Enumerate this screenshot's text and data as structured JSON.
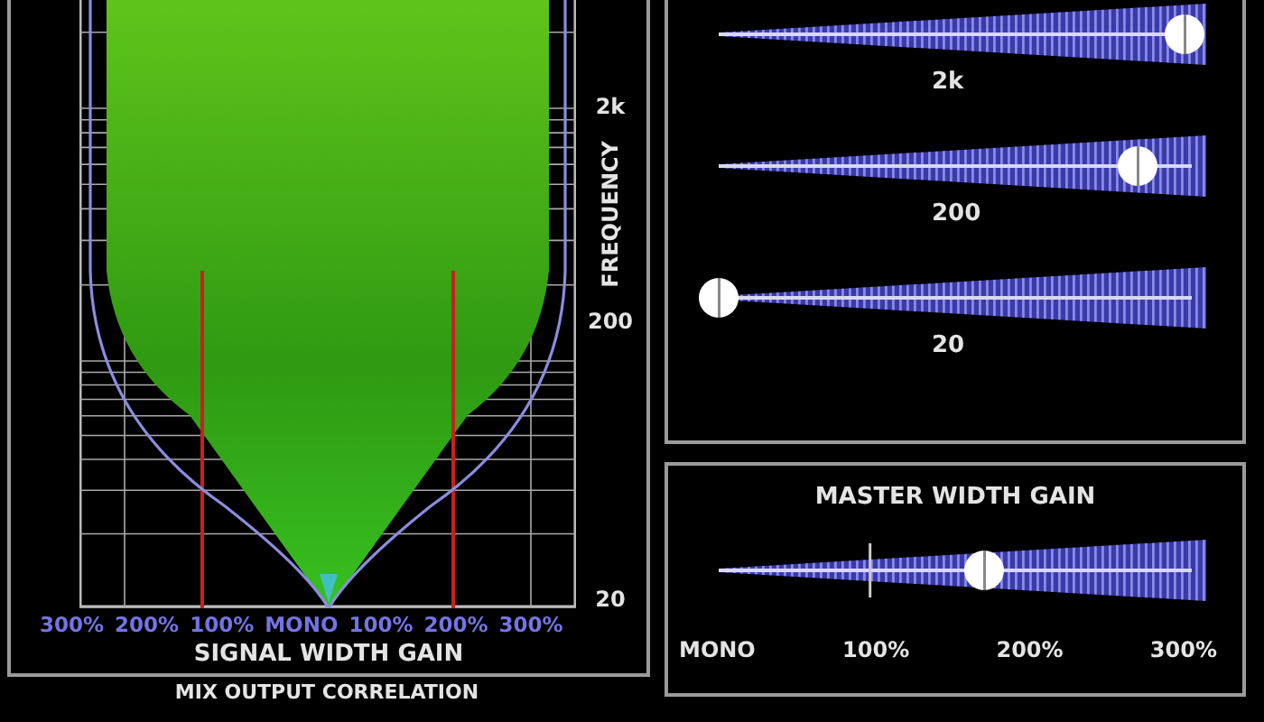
{
  "spectrum": {
    "frequency_label": "FREQUENCY",
    "frequency_ticks": [
      "2k",
      "200",
      "20"
    ],
    "width_scale": [
      "300%",
      "200%",
      "100%",
      "MONO",
      "100%",
      "200%",
      "300%"
    ],
    "title": "SIGNAL WIDTH GAIN"
  },
  "bands": [
    {
      "label": "2k",
      "level": 1.0
    },
    {
      "label": "200",
      "level": 0.9
    },
    {
      "label": "20",
      "level": 0
    }
  ],
  "master": {
    "title": "MASTER WIDTH GAIN",
    "level": 0.57,
    "scale": [
      "MONO",
      "100%",
      "200%",
      "300%"
    ]
  },
  "correlation": {
    "title": "MIX OUTPUT CORRELATION"
  }
}
